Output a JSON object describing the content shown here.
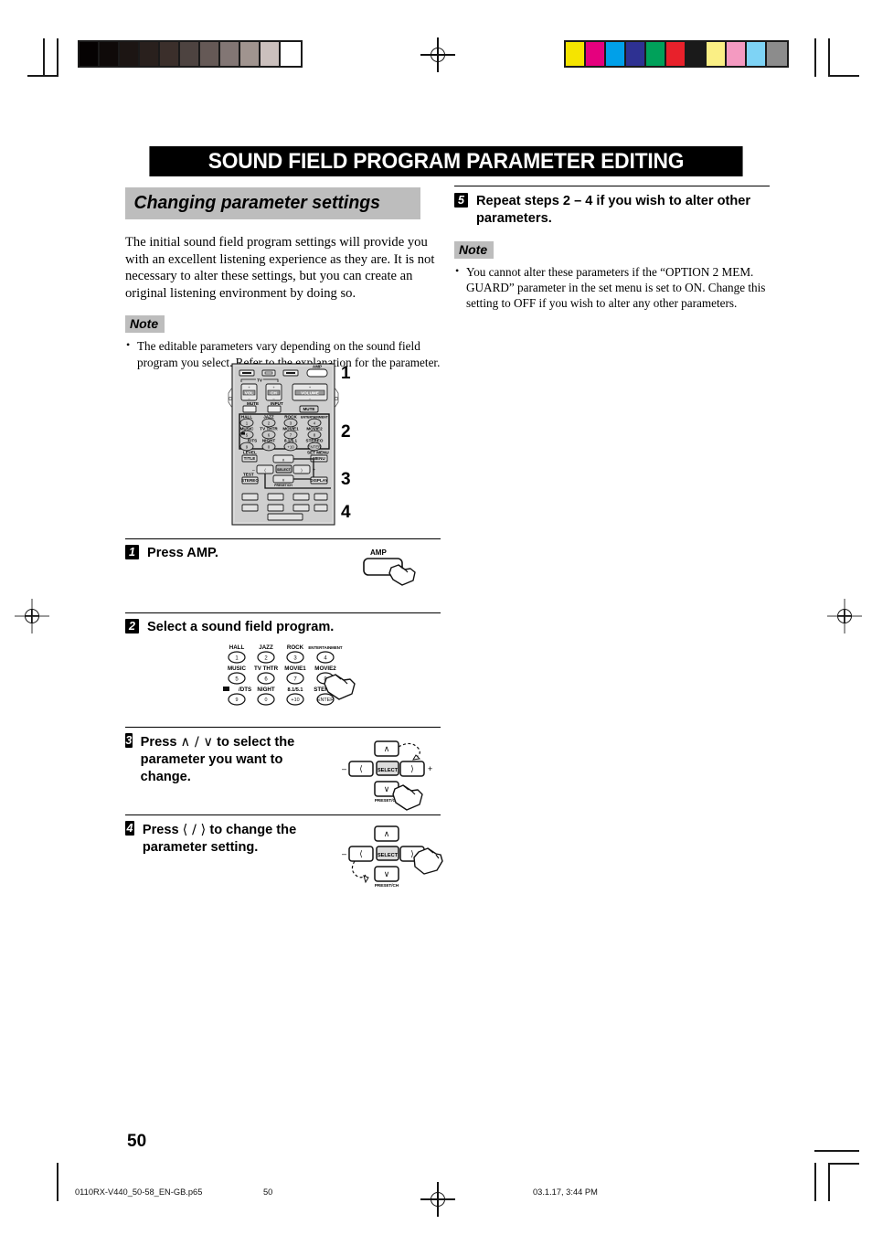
{
  "document": {
    "chapter_title": "SOUND FIELD PROGRAM PARAMETER EDITING",
    "page_number": "50"
  },
  "left_column": {
    "section_heading": "Changing parameter settings",
    "intro_paragraph": "The initial sound field program settings will provide you with an excellent listening experience as they are. It is not necessary to alter these settings, but you can create an original listening environment by doing so.",
    "note_label": "Note",
    "note_items": [
      "The editable parameters vary depending on the sound field program you select. Refer to the explanation for the parameter."
    ]
  },
  "right_column": {
    "step5": {
      "number": "5",
      "text": "Repeat steps 2 – 4 if you wish to alter other parameters."
    },
    "note_label": "Note",
    "note_items": [
      "You cannot alter these parameters if the “OPTION 2 MEM. GUARD” parameter in the set menu is set to ON. Change this setting to OFF if you wish to alter any other parameters."
    ]
  },
  "remote_diagram": {
    "callouts": [
      "1",
      "2",
      "3",
      "4"
    ],
    "top_row_labels": [
      "TV",
      "AMP"
    ],
    "tv_controls": [
      "VOL",
      "CH",
      "VOLUME",
      "MUTE",
      "INPUT",
      "MUTE"
    ],
    "sound_field_buttons": [
      {
        "name": "HALL",
        "number": "1"
      },
      {
        "name": "JAZZ",
        "number": "2"
      },
      {
        "name": "ROCK",
        "number": "3"
      },
      {
        "name": "ENTERTAINMENT",
        "number": "4"
      },
      {
        "name": "MUSIC",
        "number": "5"
      },
      {
        "name": "TV THTR",
        "number": "6"
      },
      {
        "name": "MOVIE1",
        "number": "7"
      },
      {
        "name": "MOVIE2",
        "number": "8"
      },
      {
        "name": "/DTS",
        "number": "9"
      },
      {
        "name": "NIGHT",
        "number": "0"
      },
      {
        "name": "8.1/5.1",
        "number": "+10"
      },
      {
        "name": "STEREO",
        "number": "ENTER"
      }
    ],
    "nav_cluster": {
      "title_button": "TITLE",
      "menu_button": "MENU",
      "level_label": "LEVEL",
      "set_menu_label": "SET MENU",
      "select_button": "SELECT",
      "test_label": "TEST",
      "stereo_button": "STEREO",
      "display_button": "DISPLAY",
      "preset_label": "PRESET/CH",
      "minus": "–",
      "plus": "+"
    }
  },
  "steps": [
    {
      "number": "1",
      "text": "Press AMP.",
      "figure_label": "AMP"
    },
    {
      "number": "2",
      "text": "Select a sound field program.",
      "figure_label": ""
    },
    {
      "number": "3",
      "text_before": "Press",
      "glyph": "∧ / ∨",
      "text_after": "to select the parameter you want to change.",
      "figure_label": "PRESET/CH"
    },
    {
      "number": "4",
      "text_before": "Press",
      "glyph": "⟨ / ⟩",
      "text_after": "to change the parameter setting.",
      "figure_label": "PRESET/CH"
    }
  ],
  "print_marks": {
    "grayscale_wedge": [
      "#050202",
      "#0f0a09",
      "#1c1513",
      "#29201d",
      "#3b2f2b",
      "#4d4340",
      "#655956",
      "#827674",
      "#a0948f",
      "#cbc0bd",
      "#ffffff"
    ],
    "color_bars": [
      "#f5e400",
      "#e5007e",
      "#00a0e9",
      "#2e3192",
      "#00a15a",
      "#e8212b",
      "#1a1a1a",
      "#faef85",
      "#f49ac1",
      "#7ed3f5",
      "#8c8c8c"
    ]
  },
  "footer": {
    "filename": "0110RX-V440_50-58_EN-GB.p65",
    "page": "50",
    "timestamp": "03.1.17, 3:44 PM"
  }
}
